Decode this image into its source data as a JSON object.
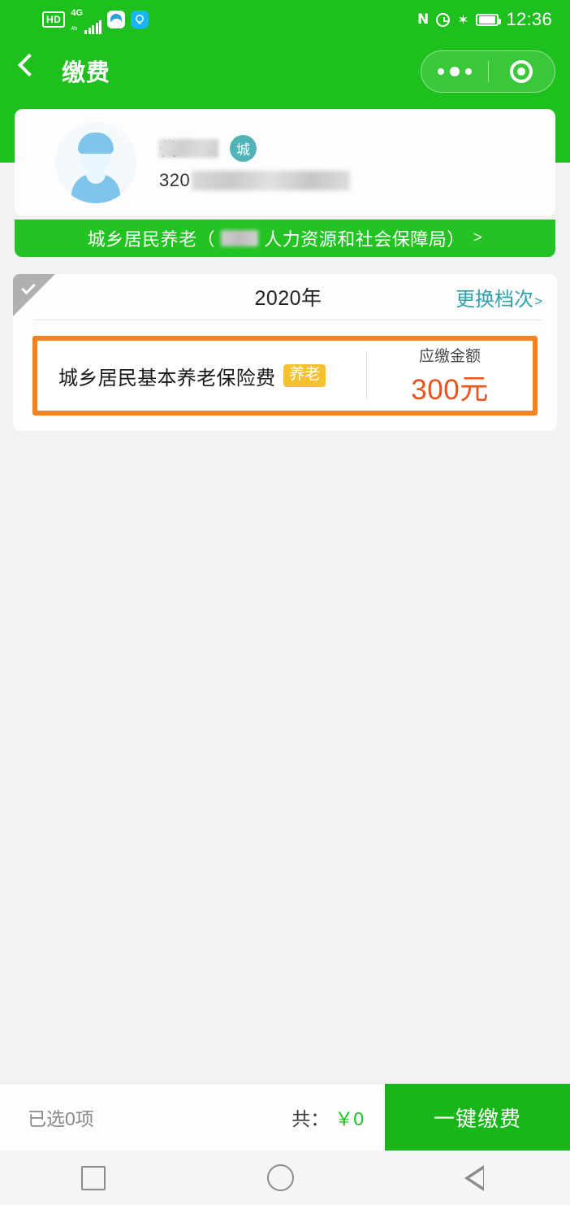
{
  "status_bar": {
    "hd_label": "HD",
    "network_type": "4G",
    "network_sub": "4b",
    "icons": [
      "hd-badge",
      "signal-bars",
      "app-icon-white",
      "app-icon-bulb",
      "nfc-icon",
      "alarm-icon",
      "bluetooth-icon",
      "battery-icon"
    ],
    "nfc_glyph": "N",
    "bluetooth_glyph": "✶",
    "time": "12:36"
  },
  "nav": {
    "back_icon": "back-chevron-icon",
    "title": "缴费",
    "capsule": {
      "more_icon": "more-dots-icon",
      "target_icon": "target-circle-icon"
    }
  },
  "user_card": {
    "avatar_icon": "user-avatar-icon",
    "name_prefix": "代",
    "name_masked": true,
    "badge": "城",
    "id_prefix": "320",
    "id_masked": true
  },
  "org_bar": {
    "text_before": "城乡居民养老（",
    "masked": true,
    "text_after": "人力资源和社会保障局）",
    "arrow": ">"
  },
  "pay_card": {
    "selected": false,
    "check_icon": "check-mark-icon",
    "year": "2020年",
    "change_tier_label": "更换档次",
    "change_tier_arrow": ">",
    "item": {
      "name": "城乡居民基本养老保险费",
      "tag": "养老",
      "amount_label": "应缴金额",
      "amount_value": "300元"
    }
  },
  "bottom_bar": {
    "selected_text": "已选",
    "selected_full": "已选０项",
    "selected_label": "已选0项",
    "total_label": "共：",
    "total_amount": "￥0",
    "pay_button": "一键缴费"
  },
  "android_nav": {
    "recents_icon": "recents-square-icon",
    "home_icon": "home-circle-icon",
    "back_icon": "back-triangle-icon"
  },
  "colors": {
    "brand_green": "#1dc01d",
    "org_bar_green": "#22c322",
    "pay_button_green": "#18b618",
    "accent_orange": "#f58220",
    "amount_orange": "#e8531e",
    "tag_yellow": "#f5c131",
    "link_teal": "#2fa3a8",
    "badge_teal": "#4fb3b8"
  }
}
